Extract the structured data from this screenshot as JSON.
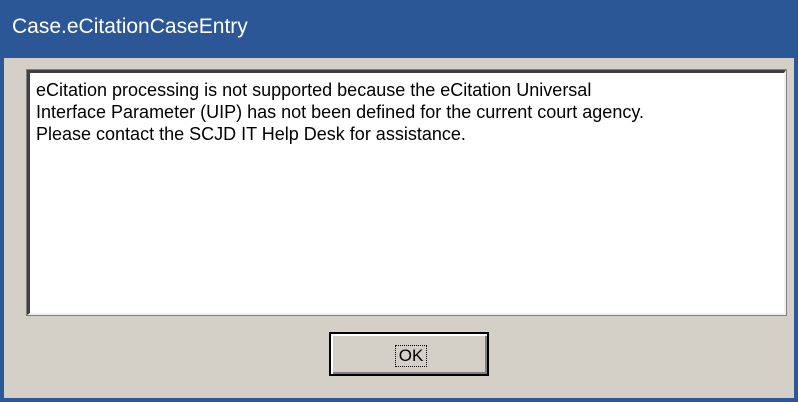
{
  "window": {
    "title": "Case.eCitationCaseEntry"
  },
  "dialog": {
    "message": "eCitation processing is not supported because the eCitation Universal\nInterface Parameter (UIP) has not been defined for the current court agency.\nPlease contact the SCJD IT Help Desk for assistance.",
    "ok_label": "OK"
  },
  "colors": {
    "titlebar": "#2b5797",
    "title_text": "#ffffff",
    "dialog_background": "#d4d0c8",
    "message_background": "#ffffff"
  }
}
